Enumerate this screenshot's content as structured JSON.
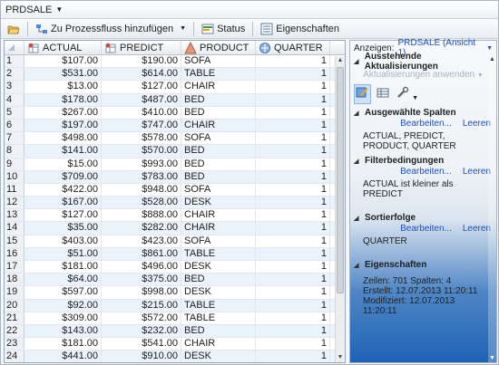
{
  "window": {
    "title": "PRDSALE"
  },
  "toolbar": {
    "add_to_flow": "Zu Prozessfluss hinzufügen",
    "status": "Status",
    "properties": "Eigenschaften"
  },
  "grid": {
    "columns": [
      {
        "name": "ACTUAL",
        "icon": "numeric-column-icon"
      },
      {
        "name": "PREDICT",
        "icon": "numeric-column-icon"
      },
      {
        "name": "PRODUCT",
        "icon": "character-column-icon"
      },
      {
        "name": "QUARTER",
        "icon": "numeric-column-icon"
      }
    ],
    "rows": [
      [
        "1",
        "$107.00",
        "$190.00",
        "SOFA",
        "1"
      ],
      [
        "2",
        "$531.00",
        "$614.00",
        "TABLE",
        "1"
      ],
      [
        "3",
        "$13.00",
        "$127.00",
        "CHAIR",
        "1"
      ],
      [
        "4",
        "$178.00",
        "$487.00",
        "BED",
        "1"
      ],
      [
        "5",
        "$267.00",
        "$410.00",
        "BED",
        "1"
      ],
      [
        "6",
        "$197.00",
        "$747.00",
        "CHAIR",
        "1"
      ],
      [
        "7",
        "$498.00",
        "$578.00",
        "SOFA",
        "1"
      ],
      [
        "8",
        "$141.00",
        "$570.00",
        "BED",
        "1"
      ],
      [
        "9",
        "$15.00",
        "$993.00",
        "BED",
        "1"
      ],
      [
        "10",
        "$709.00",
        "$783.00",
        "BED",
        "1"
      ],
      [
        "11",
        "$422.00",
        "$948.00",
        "SOFA",
        "1"
      ],
      [
        "12",
        "$167.00",
        "$528.00",
        "DESK",
        "1"
      ],
      [
        "13",
        "$127.00",
        "$888.00",
        "CHAIR",
        "1"
      ],
      [
        "14",
        "$35.00",
        "$282.00",
        "CHAIR",
        "1"
      ],
      [
        "15",
        "$403.00",
        "$423.00",
        "SOFA",
        "1"
      ],
      [
        "16",
        "$51.00",
        "$861.00",
        "TABLE",
        "1"
      ],
      [
        "17",
        "$181.00",
        "$496.00",
        "DESK",
        "1"
      ],
      [
        "18",
        "$64.00",
        "$375.00",
        "BED",
        "1"
      ],
      [
        "19",
        "$597.00",
        "$998.00",
        "DESK",
        "1"
      ],
      [
        "20",
        "$92.00",
        "$215.00",
        "TABLE",
        "1"
      ],
      [
        "21",
        "$309.00",
        "$572.00",
        "TABLE",
        "1"
      ],
      [
        "22",
        "$143.00",
        "$232.00",
        "BED",
        "1"
      ],
      [
        "23",
        "$181.00",
        "$541.00",
        "CHAIR",
        "1"
      ],
      [
        "24",
        "$441.00",
        "$910.00",
        "DESK",
        "1"
      ]
    ]
  },
  "panel": {
    "view_label": "Anzeigen:",
    "view_value": "PRDSALE (Ansicht 1)",
    "pending_title": "Ausstehende Aktualisierungen",
    "apply_updates": "Aktualisierungen anwenden",
    "selected_cols_title": "Ausgewählte Spalten",
    "edit": "Bearbeiten...",
    "clear": "Leeren",
    "selected_cols_text": "ACTUAL, PREDICT, PRODUCT, QUARTER",
    "filter_title": "Filterbedingungen",
    "filter_text": "ACTUAL ist kleiner als PREDICT",
    "sort_title": "Sortierfolge",
    "sort_text": "QUARTER",
    "props_title": "Eigenschaften",
    "rows_line": "Zeilen:  701  Spalten:  4",
    "created_line": "Erstellt:  12.07.2013 11:20:11",
    "modified_line": "Modifiziert:  12.07.2013 11:20:11"
  }
}
